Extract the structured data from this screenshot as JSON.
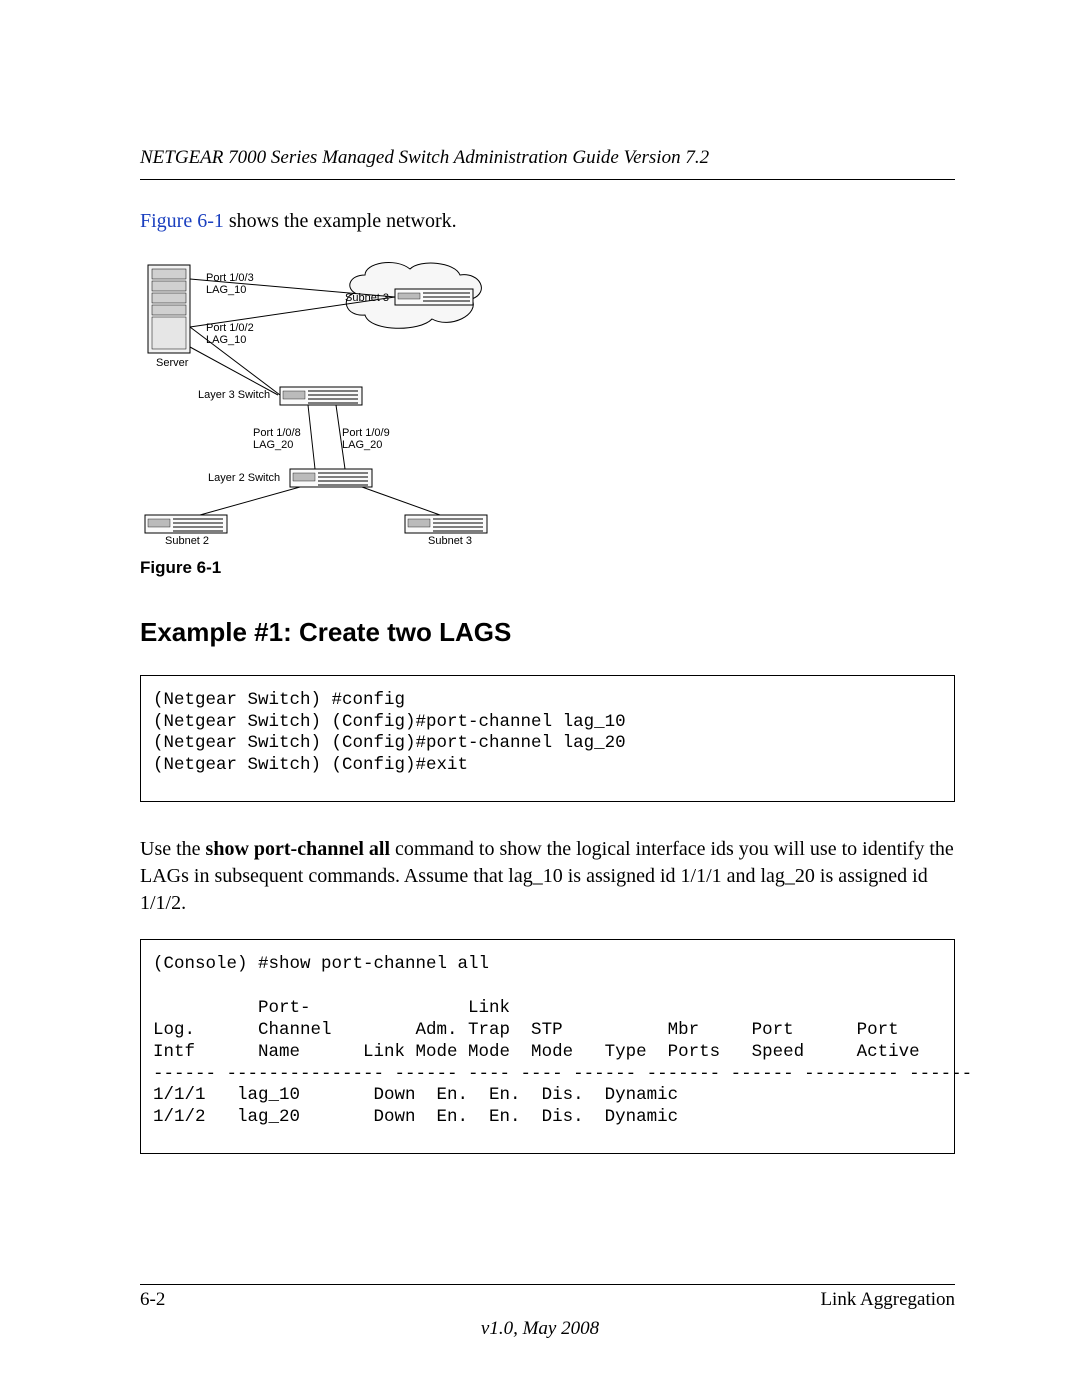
{
  "header": {
    "running_head": "NETGEAR 7000 Series Managed Switch Administration Guide Version 7.2"
  },
  "intro": {
    "figref": "Figure 6-1",
    "after": " shows the example network."
  },
  "diagram": {
    "labels": {
      "server": "Server",
      "port_103": "Port 1/0/3\nLAG_10",
      "port_102": "Port 1/0/2\nLAG_10",
      "subnet3_cloud": "Subnet 3",
      "l3": "Layer 3 Switch",
      "port_108": "Port 1/0/8\nLAG_20",
      "port_109": "Port 1/0/9\nLAG_20",
      "l2": "Layer 2 Switch",
      "subnet2": "Subnet 2",
      "subnet3_bottom": "Subnet 3"
    }
  },
  "figure_caption": "Figure 6-1",
  "heading": "Example #1: Create two LAGS",
  "code1": "(Netgear Switch) #config\n(Netgear Switch) (Config)#port-channel lag_10\n(Netgear Switch) (Config)#port-channel lag_20\n(Netgear Switch) (Config)#exit",
  "para2": {
    "pre": "Use the ",
    "bold": "show port-channel all",
    "post": " command to show the logical interface ids you will use to identify the LAGs in subsequent commands. Assume that lag_10 is assigned id 1/1/1 and lag_20 is assigned id 1/1/2."
  },
  "code2": "(Console) #show port-channel all\n\n          Port-               Link\nLog.      Channel        Adm. Trap  STP          Mbr     Port      Port\nIntf      Name      Link Mode Mode  Mode   Type  Ports   Speed     Active\n------ --------------- ------ ---- ---- ------ ------- ------ --------- ------\n1/1/1   lag_10       Down  En.  En.  Dis.  Dynamic\n1/1/2   lag_20       Down  En.  En.  Dis.  Dynamic",
  "footer": {
    "page_num": "6-2",
    "section": "Link Aggregation",
    "version": "v1.0, May 2008"
  }
}
